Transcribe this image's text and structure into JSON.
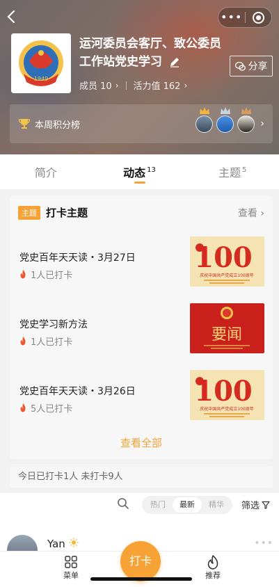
{
  "header": {
    "group_name": "运河委员会客厅、致公委员工作站党史学习",
    "share_label": "分享",
    "members_label": "成员 10",
    "activity_label": "活力值 162",
    "weekly_rank_label": "本周积分榜",
    "logo_year": "1949"
  },
  "tabs": [
    {
      "label": "简介",
      "count": ""
    },
    {
      "label": "动态",
      "count": "13"
    },
    {
      "label": "主题",
      "count": "5"
    }
  ],
  "topics": {
    "tag": "主题",
    "title": "打卡主题",
    "view_label": "查看",
    "items": [
      {
        "title": "党史百年天天读・3月27日",
        "count": "1人已打卡",
        "thumb": "100"
      },
      {
        "title": "党史学习新方法",
        "count": "1人已打卡",
        "thumb": "要闻"
      },
      {
        "title": "党史百年天天读・3月26日",
        "count": "5人已打卡",
        "thumb": "100"
      }
    ],
    "view_all": "查看全部",
    "thumb_caption": "庆祝中国共产党成立100周年"
  },
  "checkin_status": "今日已打卡1人  未打卡9人",
  "filter": {
    "segments": [
      "热门",
      "最新",
      "精华"
    ],
    "active_segment": "最新",
    "filter_label": "筛选"
  },
  "feed": {
    "user_name": "Yan"
  },
  "bottom_nav": {
    "menu_label": "菜单",
    "checkin_label": "打卡",
    "recommend_label": "推荐"
  },
  "colors": {
    "accent": "#f7a234",
    "party_red": "#d42b1e"
  }
}
